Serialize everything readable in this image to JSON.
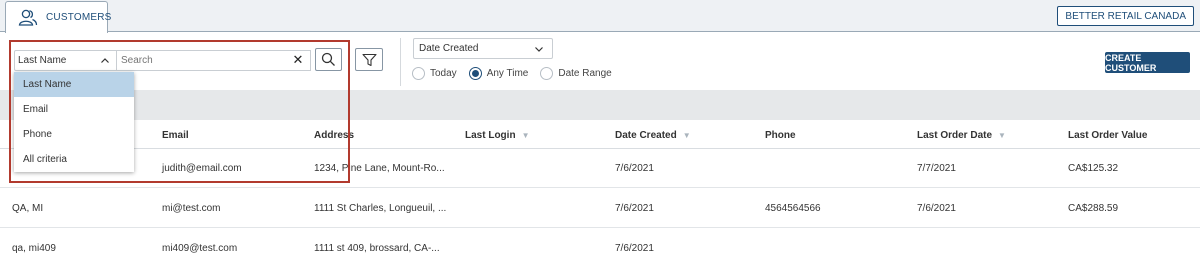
{
  "tabs": [
    {
      "label": "CUSTOMERS",
      "icon": "users-icon"
    }
  ],
  "org_button": "BETTER RETAIL CANADA",
  "search": {
    "type_selected": "Last Name",
    "placeholder": "Search",
    "value": "",
    "type_options": [
      "Last Name",
      "Email",
      "Phone",
      "All criteria"
    ]
  },
  "date_filter": {
    "selected": "Date Created",
    "radios": [
      {
        "label": "Today",
        "checked": false
      },
      {
        "label": "Any Time",
        "checked": true
      },
      {
        "label": "Date Range",
        "checked": false
      }
    ]
  },
  "create_button": "CREATE CUSTOMER",
  "table": {
    "columns": [
      "Email",
      "Address",
      "Last Login",
      "Date Created",
      "Phone",
      "Last Order Date",
      "Last Order Value"
    ],
    "rows": [
      {
        "name": "",
        "email": "judith@email.com",
        "address": "1234, Pine Lane, Mount-Ro...",
        "last_login": "",
        "date_created": "7/6/2021",
        "phone": "",
        "last_order_date": "7/7/2021",
        "last_order_value": "CA$125.32"
      },
      {
        "name": "QA, MI",
        "email": "mi@test.com",
        "address": "1111 St Charles, Longueuil, ...",
        "last_login": "",
        "date_created": "7/6/2021",
        "phone": "4564564566",
        "last_order_date": "7/6/2021",
        "last_order_value": "CA$288.59"
      },
      {
        "name": "qa, mi409",
        "email": "mi409@test.com",
        "address": "1111 st 409, brossard, CA-...",
        "last_login": "",
        "date_created": "7/6/2021",
        "phone": "",
        "last_order_date": "",
        "last_order_value": ""
      }
    ]
  },
  "colors": {
    "primary": "#1f4e79",
    "highlight_border": "#b23a2e",
    "selected_option": "#b9d3e8"
  }
}
